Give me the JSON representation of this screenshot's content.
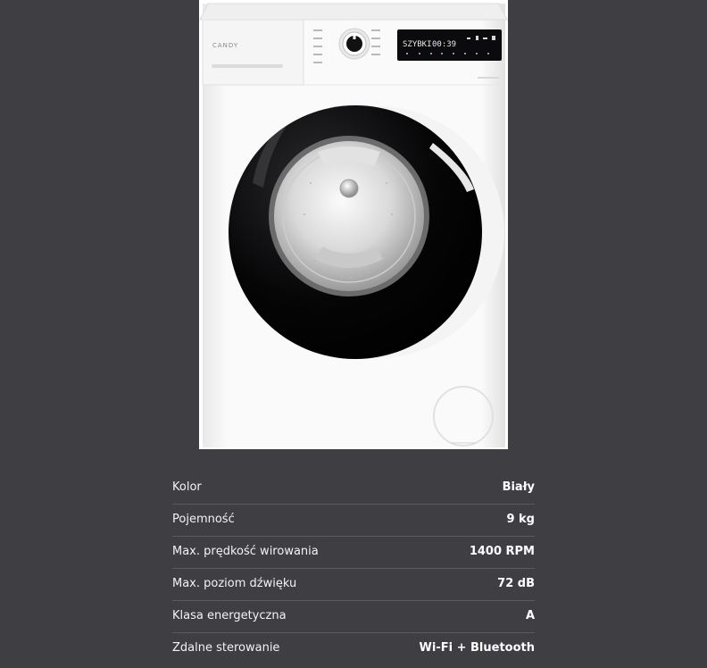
{
  "product": {
    "brand_logo_text": "CANDY",
    "display_program": "SZYBKI",
    "display_time": "00:39"
  },
  "specs": [
    {
      "label": "Kolor",
      "value": "Biały"
    },
    {
      "label": "Pojemność",
      "value": "9 kg"
    },
    {
      "label": "Max. prędkość wirowania",
      "value": "1400 RPM"
    },
    {
      "label": "Max. poziom dźwięku",
      "value": "72 dB"
    },
    {
      "label": "Klasa energetyczna",
      "value": "A"
    },
    {
      "label": "Zdalne sterowanie",
      "value": "Wi-Fi + Bluetooth"
    }
  ],
  "colors": {
    "page_background": "#3f3e43",
    "image_background": "#ffffff",
    "divider": "#5b5a60",
    "text": "#f1f1f1"
  }
}
